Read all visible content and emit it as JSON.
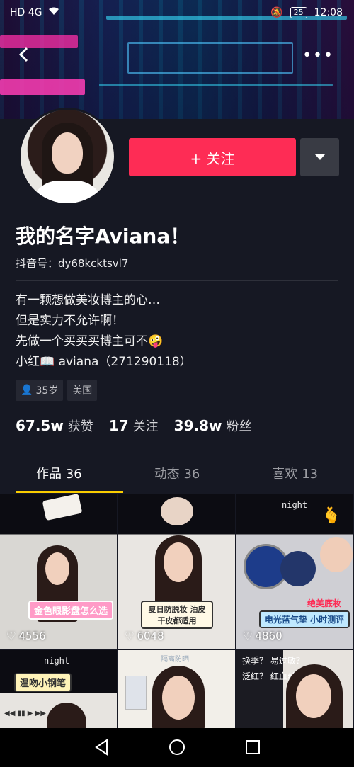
{
  "status_bar": {
    "network": "HD 4G",
    "battery": "25",
    "time": "12:08"
  },
  "banner": {
    "back_icon": "back-arrow-icon",
    "more_icon": "more-dots-icon"
  },
  "follow_button": {
    "label": "+ 关注"
  },
  "profile": {
    "name": "我的名字Aviana！",
    "douyin_id": "抖音号：dy68kcktsvl7",
    "bio": [
      "有一颗想做美妆博主的心…",
      "但是实力不允许啊！",
      "先做一个买买买博主可不🤪",
      "小红📖 aviana（271290118）"
    ],
    "tags": {
      "age": "35岁",
      "country": "美国"
    }
  },
  "stats": [
    {
      "num": "67.5w",
      "label": "获赞"
    },
    {
      "num": "17",
      "label": "关注"
    },
    {
      "num": "39.8w",
      "label": "粉丝"
    }
  ],
  "tabs": [
    "作品 36",
    "动态 36",
    "喜欢 13"
  ],
  "videos": [
    {
      "likes": "4556",
      "caption": "金色眼影盘怎么选"
    },
    {
      "likes": "6048",
      "caption": "夏日防脱妆 油皮干皮都适用"
    },
    {
      "likes": "4860",
      "caption": "电光蓝气垫 小时测评",
      "badge": "绝美底妆",
      "note": "night"
    },
    {
      "caption": "温吻小钢笔",
      "note": "night"
    },
    {
      "caption": "隔离防晒"
    },
    {
      "caption": "换季？ 易过敏？ 泛红？ 红血丝？"
    }
  ],
  "colors": {
    "accent": "#fe2c55",
    "tab_underline": "#facd00",
    "background": "#161823"
  }
}
